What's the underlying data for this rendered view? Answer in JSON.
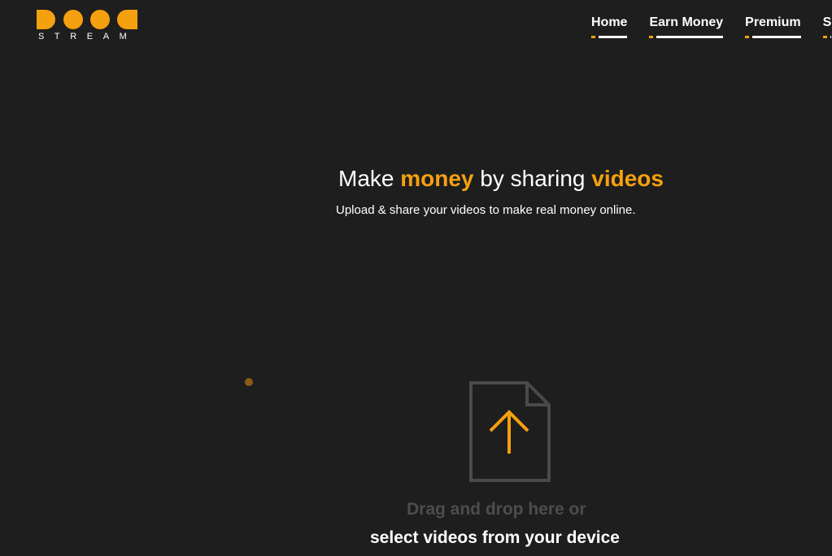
{
  "header": {
    "logo_text": "STREAM",
    "logo_alt": "Dood Stream",
    "nav": [
      {
        "label": "Home"
      },
      {
        "label": "Earn Money"
      },
      {
        "label": "Premium"
      },
      {
        "label": "S"
      }
    ]
  },
  "hero": {
    "title_part1": "Make ",
    "title_highlight1": "money",
    "title_part2": " by sharing ",
    "title_highlight2": "videos",
    "subtitle": "Upload & share your videos to make real money online."
  },
  "upload": {
    "icon": "file-upload-icon",
    "drop_text": "Drag and drop here or",
    "select_text": "select videos from your device"
  },
  "colors": {
    "background": "#1e1e1e",
    "accent": "#f5a00f",
    "text": "#ffffff",
    "muted": "#4d4d4d"
  }
}
